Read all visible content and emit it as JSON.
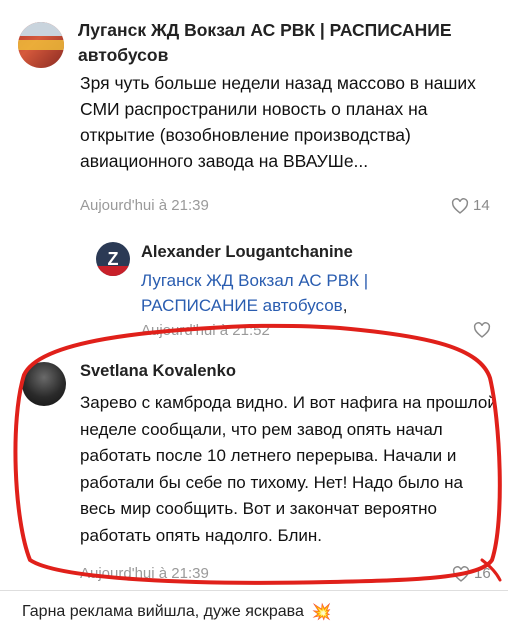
{
  "post1": {
    "author": "Луганск ЖД Вокзал АС РВК | РАСПИСАНИЕ автобусов",
    "text": "Зря чуть больше недели назад массово в наших СМИ распространили новость о планах на открытие (возобновление производства) авиационного завода на ВВАУШе...",
    "time": "Aujourd'hui à 21:39",
    "likes": "14"
  },
  "reply": {
    "author": "Alexander Lougantchanine",
    "mention": "Луганск ЖД Вокзал АС РВК | РАСПИСАНИЕ автобусов",
    "suffix": ",",
    "time": "Aujourd'hui à 21:52"
  },
  "post3": {
    "author": "Svetlana Kovalenko",
    "text": "Зарево с камброда видно. И вот нафига на прошлой неделе сообщали, что рем завод опять начал работать после 10 летнего перерыва. Начали и работали бы себе по тихому. Нет! Надо было на весь мир сообщить. Вот и закончат вероятно работать опять надолго. Блин.",
    "time": "Aujourd'hui à 21:39",
    "likes": "16"
  },
  "caption": {
    "text": "Гарна реклама вийшла, дуже яскрава",
    "emoji": "💥"
  },
  "colors": {
    "link": "#2a5db0",
    "annotation": "#e0201a",
    "meta": "#9a9a9a"
  },
  "icons": [
    "heart-icon",
    "explosion-emoji"
  ]
}
